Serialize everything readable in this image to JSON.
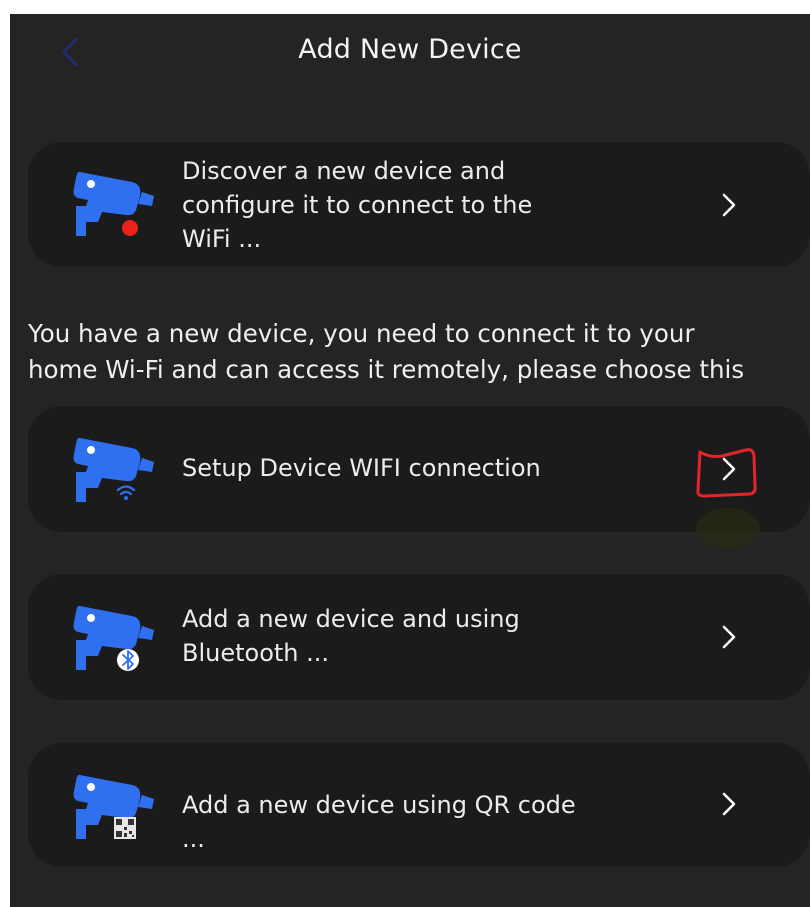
{
  "header": {
    "title": "Add New Device",
    "back_icon": "chevron-left-icon"
  },
  "options": [
    {
      "id": "discover",
      "label_lines": [
        "Discover a new device and",
        "configure it to connect to the",
        "WiFi ..."
      ],
      "icon": "camera-discover-icon",
      "badge": "red-dot"
    },
    {
      "id": "wifi-setup",
      "label_lines": [
        "Setup Device WIFI connection"
      ],
      "icon": "camera-wifi-icon",
      "badge": "wifi"
    },
    {
      "id": "bluetooth",
      "label_lines": [
        "Add a new device and using",
        "Bluetooth ..."
      ],
      "icon": "camera-bluetooth-icon",
      "badge": "bluetooth"
    },
    {
      "id": "qr-code",
      "label_lines": [
        "Add a new device using QR code ..."
      ],
      "icon": "camera-qr-icon",
      "badge": "qr-code"
    }
  ],
  "description_lines": [
    "You have a new device, you need to connect it to your",
    "home Wi-Fi and can access it remotely, please choose this"
  ],
  "colors": {
    "background": "#242424",
    "card": "#1b1b1b",
    "accent_blue": "#2f6ff0",
    "annotation_red": "#e0262b",
    "badge_red": "#e8231c"
  }
}
